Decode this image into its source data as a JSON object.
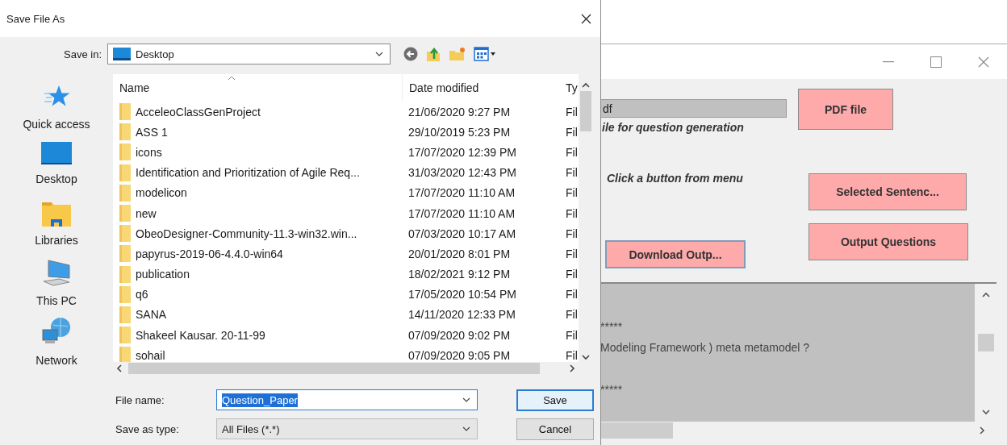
{
  "dialog": {
    "title": "Save File As",
    "save_in": {
      "label": "Save in:",
      "value": "Desktop"
    },
    "places": [
      {
        "label": "Quick access",
        "kind": "star"
      },
      {
        "label": "Desktop",
        "kind": "desktop"
      },
      {
        "label": "Libraries",
        "kind": "libraries"
      },
      {
        "label": "This PC",
        "kind": "pc"
      },
      {
        "label": "Network",
        "kind": "network"
      }
    ],
    "file_list": {
      "columns": [
        "Name",
        "Date modified",
        "Ty"
      ],
      "rows": [
        {
          "name": "AcceleoClassGenProject",
          "date": "21/06/2020 9:27 PM",
          "type": "Fil"
        },
        {
          "name": "ASS 1",
          "date": "29/10/2019 5:23 PM",
          "type": "Fil"
        },
        {
          "name": "icons",
          "date": "17/07/2020 12:39 PM",
          "type": "Fil"
        },
        {
          "name": "Identification and Prioritization of Agile Req...",
          "date": "31/03/2020 12:43 PM",
          "type": "Fil"
        },
        {
          "name": "modelicon",
          "date": "17/07/2020 11:10 AM",
          "type": "Fil"
        },
        {
          "name": "new",
          "date": "17/07/2020 11:10 AM",
          "type": "Fil"
        },
        {
          "name": "ObeoDesigner-Community-11.3-win32.win...",
          "date": "07/03/2020 10:17 AM",
          "type": "Fil"
        },
        {
          "name": "papyrus-2019-06-4.4.0-win64",
          "date": "20/01/2020 8:01 PM",
          "type": "Fil"
        },
        {
          "name": "publication",
          "date": "18/02/2021 9:12 PM",
          "type": "Fil"
        },
        {
          "name": "q6",
          "date": "17/05/2020 10:54 PM",
          "type": "Fil"
        },
        {
          "name": "SANA",
          "date": "14/11/2020 12:33 PM",
          "type": "Fil"
        },
        {
          "name": "Shakeel Kausar. 20-11-99",
          "date": "07/09/2020 9:02 PM",
          "type": "Fil"
        },
        {
          "name": "sohail",
          "date": "07/09/2020 9:05 PM",
          "type": "Fil"
        }
      ]
    },
    "file_name": {
      "label": "File name:",
      "value": "Question_Paper",
      "text_selected": true
    },
    "save_as_type": {
      "label": "Save as type:",
      "value": "All Files (*.*)"
    },
    "buttons": [
      {
        "label": "Save",
        "focused": true
      },
      {
        "label": "Cancel",
        "focused": false
      }
    ]
  },
  "app_window": {
    "path_field": {
      "value": "df"
    },
    "hint": "ile for question generation",
    "status": "Click a button from menu",
    "buttons": [
      {
        "label": "PDF file",
        "focused": false
      },
      {
        "label": "Selected Sentenc...",
        "focused": false
      },
      {
        "label": "Output Questions",
        "focused": false
      },
      {
        "label": "Download Outp...",
        "focused": true
      }
    ],
    "output_lines": [
      "*****",
      "Modeling Framework ) meta metamodel ?",
      "*****"
    ]
  }
}
